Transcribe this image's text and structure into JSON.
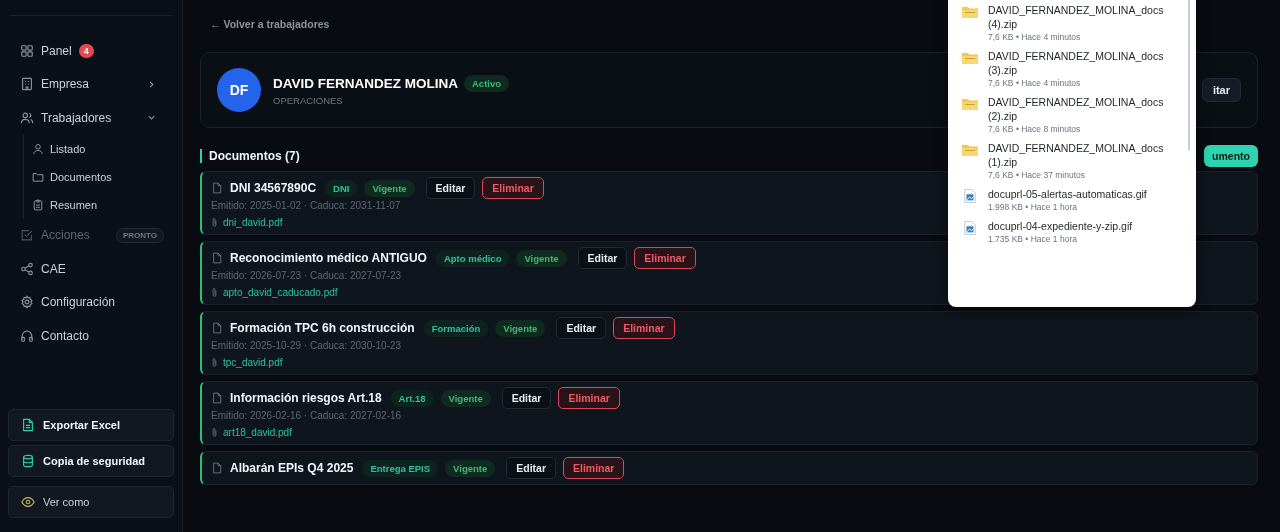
{
  "sidebar": {
    "items": [
      {
        "label": "Panel",
        "badge": "4",
        "disabled": false
      },
      {
        "label": "Empresa",
        "expanded": false,
        "disabled": false
      },
      {
        "label": "Trabajadores",
        "expanded": true,
        "disabled": false,
        "children": [
          {
            "label": "Listado"
          },
          {
            "label": "Documentos"
          },
          {
            "label": "Resumen"
          }
        ]
      },
      {
        "label": "Acciones",
        "tag": "PRONTO",
        "disabled": true
      },
      {
        "label": "CAE",
        "disabled": false
      },
      {
        "label": "Configuración",
        "disabled": false
      },
      {
        "label": "Contacto",
        "disabled": false
      }
    ],
    "actions": [
      "Exportar Excel",
      "Copia de seguridad",
      "Ver como"
    ]
  },
  "back_link": "← Volver a trabajadores",
  "worker": {
    "initials": "DF",
    "name": "DAVID FERNANDEZ MOLINA",
    "status": "Activo",
    "department": "OPERACIONES",
    "action": "itar"
  },
  "documents": {
    "title": "Documentos (7)",
    "add_button": "umento",
    "items": [
      {
        "title": "DNI 34567890C",
        "category": "DNI",
        "status": "Vigente",
        "dates": "Emitido: 2025-01-02 · Caduca: 2031-11-07",
        "file": "dni_david.pdf",
        "edit": "Editar",
        "delete": "Eliminar"
      },
      {
        "title": "Reconocimiento médico ANTIGUO",
        "category": "Apto médico",
        "status": "Vigente",
        "dates": "Emitido: 2026-07-23 · Caduca: 2027-07-23",
        "file": "apto_david_caducado.pdf",
        "edit": "Editar",
        "delete": "Eliminar"
      },
      {
        "title": "Formación TPC 6h construcción",
        "category": "Formación",
        "status": "Vigente",
        "dates": "Emitido: 2025-10-29 · Caduca: 2030-10-23",
        "file": "tpc_david.pdf",
        "edit": "Editar",
        "delete": "Eliminar"
      },
      {
        "title": "Información riesgos Art.18",
        "category": "Art.18",
        "status": "Vigente",
        "dates": "Emitido: 2026-02-16 · Caduca: 2027-02-16",
        "file": "art18_david.pdf",
        "edit": "Editar",
        "delete": "Eliminar"
      },
      {
        "title": "Albarán EPIs Q4 2025",
        "category": "Entrega EPIS",
        "status": "Vigente",
        "edit": "Editar",
        "delete": "Eliminar"
      }
    ]
  },
  "downloads": [
    {
      "kind": "zip",
      "name": "DAVID_FERNANDEZ_MOLINA_docs (4).zip",
      "meta": "7,6 KB • Hace 4 minutos"
    },
    {
      "kind": "zip",
      "name": "DAVID_FERNANDEZ_MOLINA_docs (3).zip",
      "meta": "7,6 KB • Hace 4 minutos"
    },
    {
      "kind": "zip",
      "name": "DAVID_FERNANDEZ_MOLINA_docs (2).zip",
      "meta": "7,6 KB • Hace 8 minutos"
    },
    {
      "kind": "zip",
      "name": "DAVID_FERNANDEZ_MOLINA_docs (1).zip",
      "meta": "7,6 KB • Hace 37 minutos"
    },
    {
      "kind": "gif",
      "name": "docuprl-05-alertas-automaticas.gif",
      "meta": "1.998 KB • Hace 1 hora"
    },
    {
      "kind": "gif",
      "name": "docuprl-04-expediente-y-zip.gif",
      "meta": "1.735 KB • Hace 1 hora"
    }
  ]
}
